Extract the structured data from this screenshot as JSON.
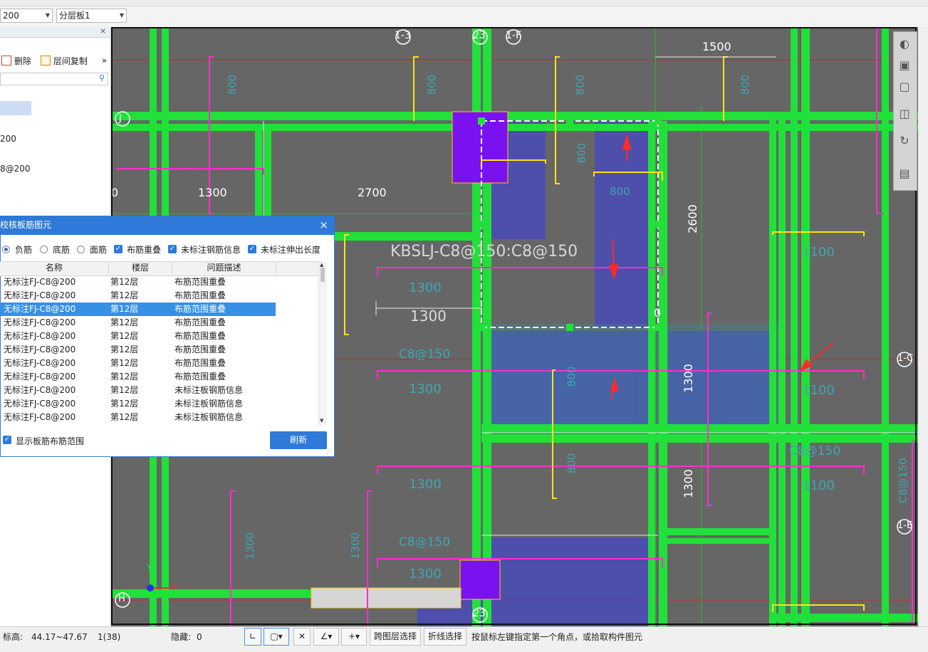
{
  "toolbar": {
    "floor_combo": "200",
    "layer_combo": "分层板1"
  },
  "left_panel": {
    "close": "×",
    "delete_label": "删除",
    "copy_label": "层间复制",
    "more": "»",
    "items": [
      "200",
      "8@200"
    ]
  },
  "canvas": {
    "annotation": "KBSLJ-C8@150:C8@150",
    "axis_labels": [
      "1-3",
      "23",
      "1-F",
      "J",
      "H",
      "23",
      "1-C",
      "1-E"
    ],
    "dims": [
      "1500",
      "1300",
      "2700",
      "2600",
      "1300",
      "0"
    ],
    "dim_small": [
      "800",
      "800",
      "800",
      "800",
      "800",
      "800",
      "1300",
      "1300",
      "1300",
      "1300",
      "1100",
      "1100",
      "1100",
      "1300",
      "1300",
      "C8@150",
      "C8@150",
      "C8@150",
      "C8@150",
      "800",
      "800",
      "1300",
      "1300"
    ],
    "edge_left": "0",
    "axis_x": "X",
    "axis_y": "Y"
  },
  "dialog": {
    "title": "校核板筋图元",
    "close": "×",
    "radios": [
      {
        "label": "负筋",
        "checked": true
      },
      {
        "label": "底筋",
        "checked": false
      },
      {
        "label": "面筋",
        "checked": false
      }
    ],
    "checks": [
      {
        "label": "布筋重叠",
        "checked": true
      },
      {
        "label": "未标注钢筋信息",
        "checked": true
      },
      {
        "label": "未标注伸出长度",
        "checked": true
      }
    ],
    "columns": [
      "名称",
      "楼层",
      "问题描述"
    ],
    "rows": [
      {
        "name": "无标注FJ-C8@200",
        "floor": "第12层",
        "desc": "布筋范围重叠"
      },
      {
        "name": "无标注FJ-C8@200",
        "floor": "第12层",
        "desc": "布筋范围重叠"
      },
      {
        "name": "无标注FJ-C8@200",
        "floor": "第12层",
        "desc": "布筋范围重叠"
      },
      {
        "name": "无标注FJ-C8@200",
        "floor": "第12层",
        "desc": "布筋范围重叠"
      },
      {
        "name": "无标注FJ-C8@200",
        "floor": "第12层",
        "desc": "布筋范围重叠"
      },
      {
        "name": "无标注FJ-C8@200",
        "floor": "第12层",
        "desc": "布筋范围重叠"
      },
      {
        "name": "无标注FJ-C8@200",
        "floor": "第12层",
        "desc": "布筋范围重叠"
      },
      {
        "name": "无标注FJ-C8@200",
        "floor": "第12层",
        "desc": "布筋范围重叠"
      },
      {
        "name": "无标注FJ-C8@200",
        "floor": "第12层",
        "desc": "未标注板钢筋信息"
      },
      {
        "name": "无标注FJ-C8@200",
        "floor": "第12层",
        "desc": "未标注板钢筋信息"
      },
      {
        "name": "无标注FJ-C8@200",
        "floor": "第12层",
        "desc": "未标注板钢筋信息"
      }
    ],
    "selected_row": 2,
    "show_range_label": "显示板筋布筋范围",
    "refresh_label": "刷新"
  },
  "status": {
    "elevation_label": "标高:",
    "elevation_value": "44.17~47.67",
    "count": "1(38)",
    "hidden_label": "隐藏:",
    "hidden_value": "0",
    "cross_layer": "跨图层选择",
    "polyline": "折线选择",
    "hint": "按鼠标左键指定第一个角点，或拾取构件图元"
  },
  "colors": {
    "beam_green": "#22e03a",
    "magenta": "#ff2ccf",
    "yellow": "#ffe21a",
    "slab_blue": "#3a3aa8",
    "purple": "#7a12f0",
    "dialog_blue": "#2f7ad8"
  }
}
